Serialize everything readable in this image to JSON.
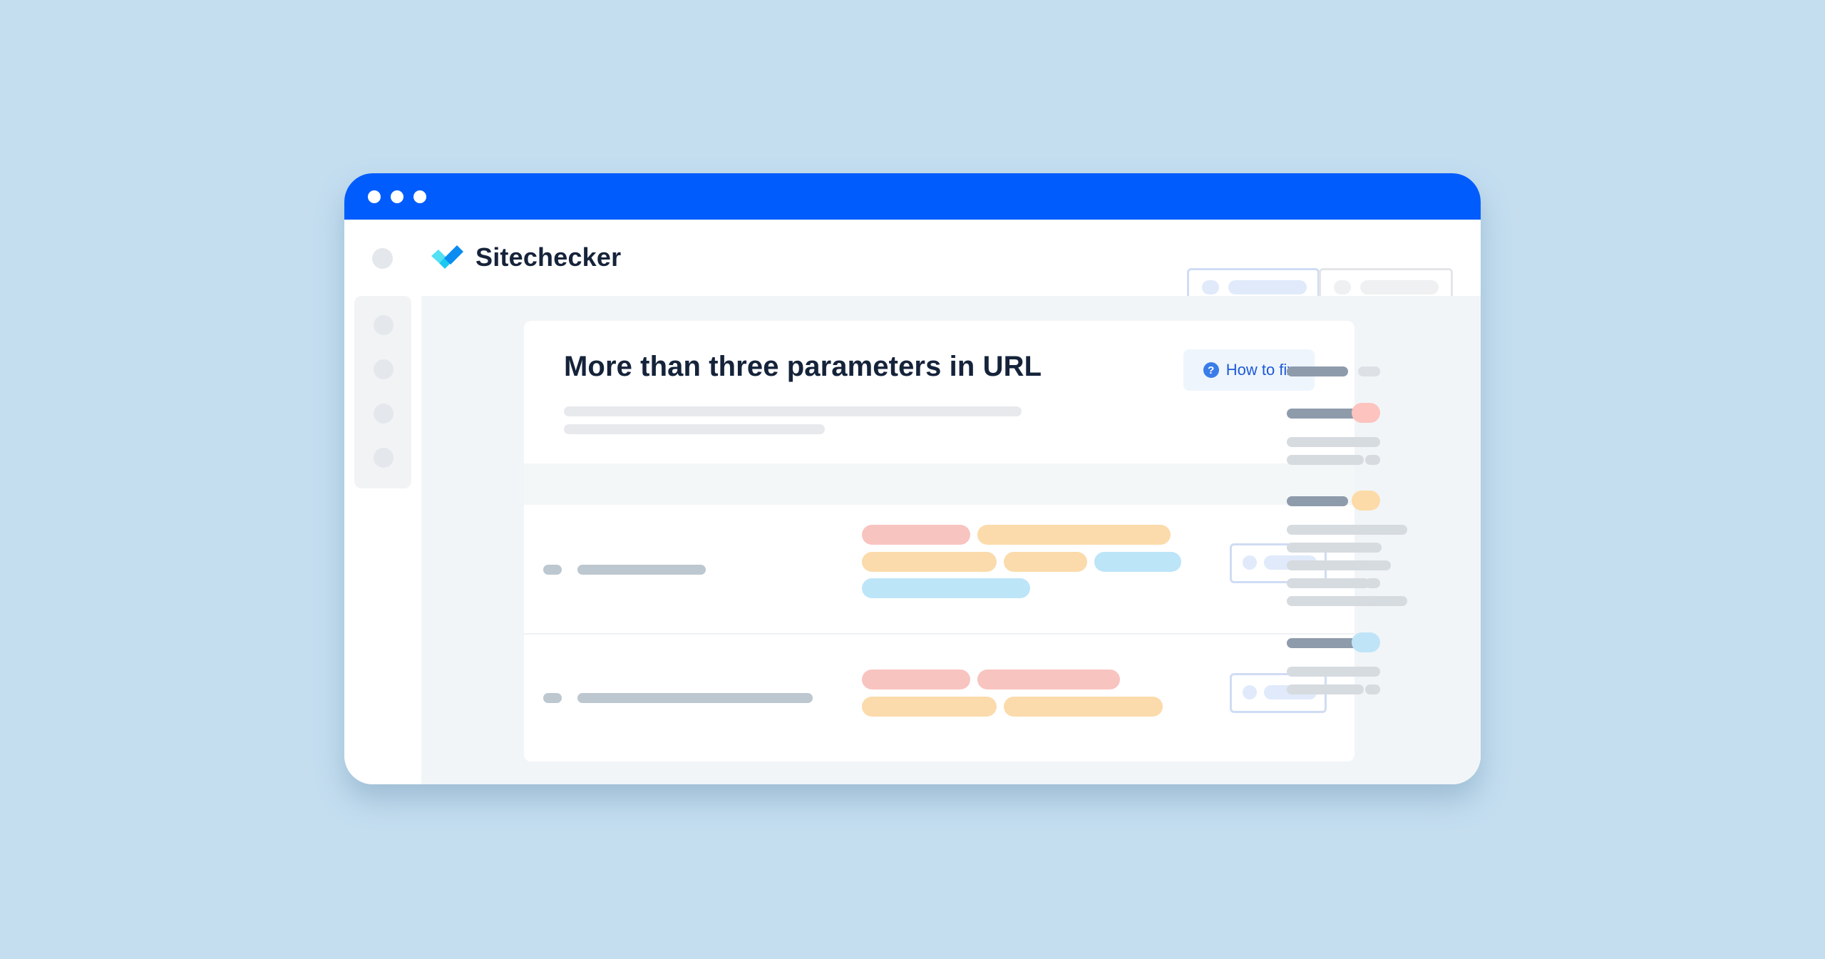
{
  "window": {
    "controls": [
      "window-dot-1",
      "window-dot-2",
      "window-dot-3"
    ],
    "titlebar_color": "#005cfc"
  },
  "header": {
    "brand": "Sitechecker",
    "brand_color": "#16233a",
    "logo_colors": [
      "#52e0f2",
      "#0a8cf0",
      "#1bc8ef"
    ]
  },
  "issue": {
    "title": "More than three parameters in URL",
    "how_to_fix_label": "How to fix",
    "how_to_fix_icon": "question-circle-icon",
    "how_to_fix_icon_glyph": "?"
  },
  "tag_colors": {
    "red": "#f8c4c0",
    "orange": "#fbdbab",
    "blue": "#bde5f8"
  },
  "table": {
    "rows": [
      {
        "tags": [
          [
            "red",
            "orange"
          ],
          [
            "orange",
            "orange",
            "blue"
          ],
          [
            "blue"
          ]
        ]
      },
      {
        "tags": [
          [
            "red",
            "red"
          ],
          [
            "orange",
            "orange"
          ]
        ]
      }
    ]
  },
  "right_sidebar": {
    "groups": [
      {
        "badge": "gray",
        "sub_items": 0
      },
      {
        "badge": "red",
        "sub_items": 2
      },
      {
        "badge": "orange",
        "sub_items": 5
      },
      {
        "badge": "blue",
        "sub_items": 2
      }
    ]
  }
}
